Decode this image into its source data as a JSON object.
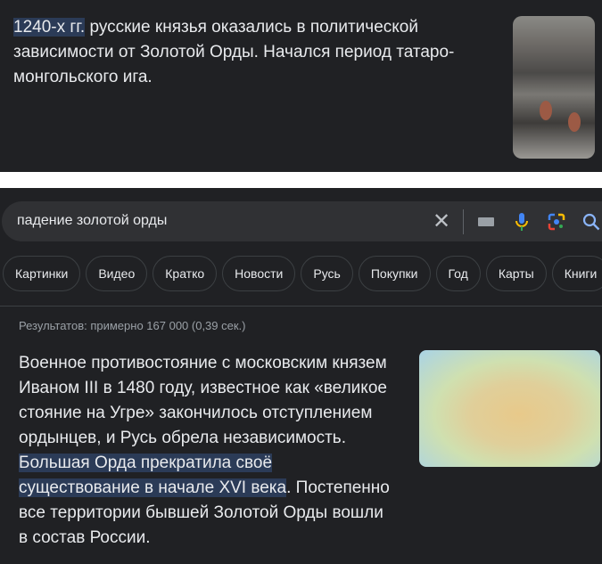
{
  "top_snippet": {
    "highlight": "1240-х гг.",
    "text": " русские князья оказались в политической зависимости от Золотой Орды. Начался период татаро-монгольского ига."
  },
  "search": {
    "query": "падение золотой орды"
  },
  "chips": [
    "Картинки",
    "Видео",
    "Кратко",
    "Новости",
    "Русь",
    "Покупки",
    "Год",
    "Карты",
    "Книги"
  ],
  "stats": "Результатов: примерно 167 000 (0,39 сек.)",
  "featured_snippet": {
    "text_before": "Военное противостояние с московским князем Иваном III в 1480 году, известное как «великое стояние на Угре» закончилось отступлением ордынцев, и Русь обрела независимость. ",
    "highlight": "Большая Орда прекратила своё существование в начале XVI века",
    "text_after": ". Постепенно все территории бывшей Золотой Орды вошли в состав России."
  }
}
